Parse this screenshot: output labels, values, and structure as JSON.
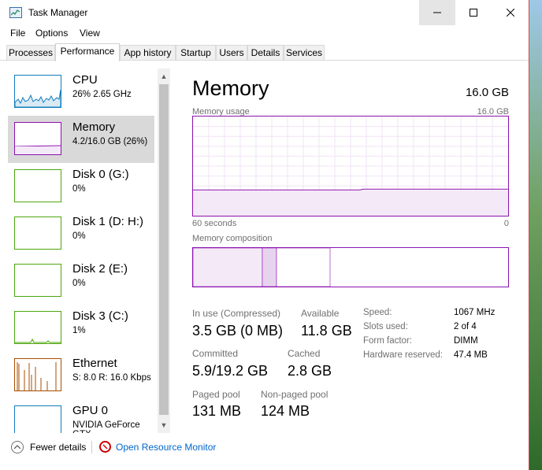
{
  "window": {
    "title": "Task Manager",
    "accent": "#8b12ae"
  },
  "menu": [
    "File",
    "Options",
    "View"
  ],
  "tabs": [
    "Processes",
    "Performance",
    "App history",
    "Startup",
    "Users",
    "Details",
    "Services"
  ],
  "active_tab": "Performance",
  "sidebar": {
    "items": [
      {
        "name": "CPU",
        "sub": "26% 2.65 GHz",
        "color": "#117dbb",
        "selected": false
      },
      {
        "name": "Memory",
        "sub": "4.2/16.0 GB (26%)",
        "color": "#8b12ae",
        "selected": true
      },
      {
        "name": "Disk 0 (G:)",
        "sub": "0%",
        "color": "#4da60c",
        "selected": false
      },
      {
        "name": "Disk 1 (D: H:)",
        "sub": "0%",
        "color": "#4da60c",
        "selected": false
      },
      {
        "name": "Disk 2 (E:)",
        "sub": "0%",
        "color": "#4da60c",
        "selected": false
      },
      {
        "name": "Disk 3 (C:)",
        "sub": "1%",
        "color": "#4da60c",
        "selected": false
      },
      {
        "name": "Ethernet",
        "sub": "S: 8.0 R: 16.0 Kbps",
        "color": "#a74f01",
        "selected": false
      },
      {
        "name": "GPU 0",
        "sub": "NVIDIA GeForce GTX",
        "color": "#117dbb",
        "selected": false
      }
    ]
  },
  "main": {
    "title": "Memory",
    "total": "16.0 GB",
    "usage_label": "Memory usage",
    "usage_max": "16.0 GB",
    "time_label": "60 seconds",
    "time_end": "0",
    "usage_fraction": 0.26,
    "composition_label": "Memory composition",
    "composition": {
      "in_use_fraction": 0.22,
      "modified_fraction": 0.045,
      "standby_fraction": 0.17
    },
    "stats": {
      "in_use_label": "In use (Compressed)",
      "in_use_value": "3.5 GB (0 MB)",
      "available_label": "Available",
      "available_value": "11.8 GB",
      "committed_label": "Committed",
      "committed_value": "5.9/19.2 GB",
      "cached_label": "Cached",
      "cached_value": "2.8 GB",
      "paged_label": "Paged pool",
      "paged_value": "131 MB",
      "nonpaged_label": "Non-paged pool",
      "nonpaged_value": "124 MB"
    },
    "details": [
      {
        "key": "Speed:",
        "value": "1067 MHz"
      },
      {
        "key": "Slots used:",
        "value": "2 of 4"
      },
      {
        "key": "Form factor:",
        "value": "DIMM"
      },
      {
        "key": "Hardware reserved:",
        "value": "47.4 MB"
      }
    ]
  },
  "footer": {
    "fewer_details": "Fewer details",
    "resource_monitor": "Open Resource Monitor"
  }
}
